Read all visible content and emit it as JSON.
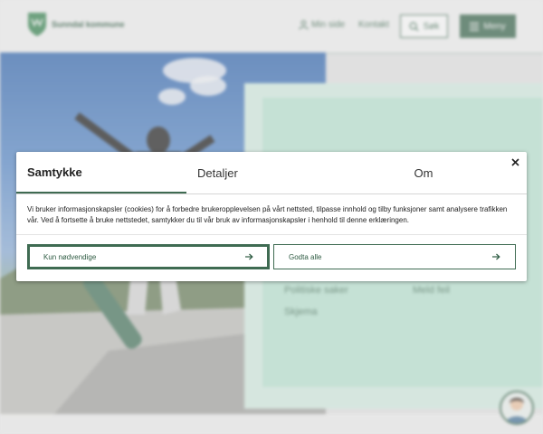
{
  "header": {
    "logo_text": "Sunndal kommune",
    "my_page": "Min side",
    "contact": "Kontakt",
    "search": "Søk",
    "menu": "Meny"
  },
  "panel": {
    "links": [
      "Politiske saker",
      "Meld feil",
      "Skjema"
    ]
  },
  "consent": {
    "tabs": [
      "Samtykke",
      "Detaljer",
      "Om"
    ],
    "active_tab": "Samtykke",
    "body": "Vi bruker informasjonskapsler (cookies) for å forbedre brukeropplevelsen på vårt nettsted, tilpasse innhold og tilby funksjoner samt analysere trafikken vår. Ved å fortsette å bruke nettstedet, samtykker du til vår bruk av informasjonskapsler i henhold til denne erklæringen.",
    "necessary_only": "Kun nødvendige",
    "accept_all": "Godta alle"
  },
  "colors": {
    "brand": "#3f6b52",
    "mint": "#bfe7d6"
  },
  "icons": {
    "close": "close-icon",
    "arrow": "arrow-right-icon",
    "search": "search-icon",
    "menu": "hamburger-icon",
    "user": "user-icon"
  }
}
